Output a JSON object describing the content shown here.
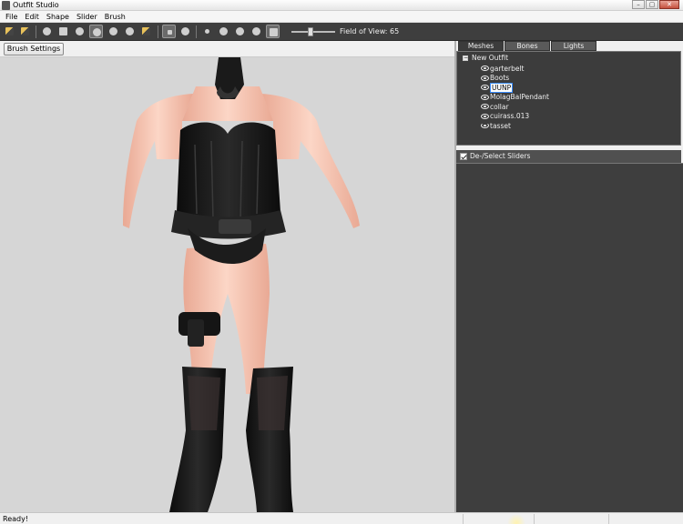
{
  "window": {
    "title": "Outfit Studio",
    "buttons": [
      "–",
      "▢",
      "✕"
    ]
  },
  "menu": [
    "File",
    "Edit",
    "Shape",
    "Slider",
    "Brush"
  ],
  "toolbar": {
    "tools": [
      "select",
      "transform",
      "standard-brush",
      "mask-brush",
      "inflate-brush",
      "deflate-brush",
      "move-brush",
      "smooth-brush",
      "undiff-brush",
      "weight-brush",
      "color-brush",
      "view-front",
      "view-left",
      "view-right",
      "view-back",
      "perspective-toggle",
      "field-of-view"
    ],
    "fov_label": "Field of View: 65",
    "fov_value": 65
  },
  "brush_settings_label": "Brush Settings >>",
  "tabs": [
    "Meshes",
    "Bones",
    "Lights"
  ],
  "active_tab": "Meshes",
  "outfit": {
    "name": "New Outfit",
    "expander": "−",
    "meshes": [
      "garterbelt",
      "Boots",
      "UUNP",
      "MolagBalPendant",
      "collar",
      "cuirass.013",
      "tasset"
    ],
    "selected": "UUNP"
  },
  "sliders": {
    "header": "De-/Select Sliders",
    "checked": true
  },
  "status": {
    "text": "Ready!"
  },
  "colors": {
    "panel_dark": "#3c3c3c",
    "viewport_bg": "#d6d6d6",
    "skin": "#f2c2ad",
    "armor": "#141414"
  }
}
